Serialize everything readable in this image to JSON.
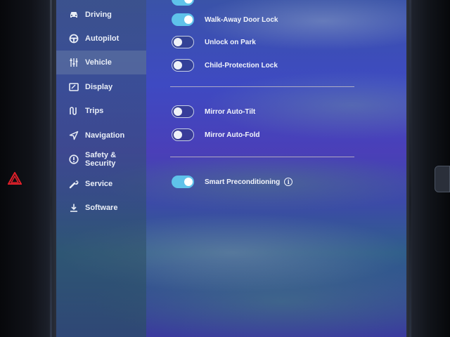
{
  "sidebar": {
    "items": [
      {
        "label": "Driving",
        "icon": "car-icon",
        "active": false
      },
      {
        "label": "Autopilot",
        "icon": "steering-wheel-icon",
        "active": false
      },
      {
        "label": "Vehicle",
        "icon": "sliders-icon",
        "active": true
      },
      {
        "label": "Display",
        "icon": "display-icon",
        "active": false
      },
      {
        "label": "Trips",
        "icon": "trips-icon",
        "active": false
      },
      {
        "label": "Navigation",
        "icon": "navigation-arrow-icon",
        "active": false
      },
      {
        "label_line1": "Safety &",
        "label_line2": "Security",
        "icon": "alert-circle-icon",
        "active": false
      },
      {
        "label": "Service",
        "icon": "wrench-icon",
        "active": false
      },
      {
        "label": "Software",
        "icon": "download-icon",
        "active": false
      }
    ]
  },
  "settings": {
    "walk_away_door_lock": {
      "label": "Walk-Away Door Lock",
      "enabled": true
    },
    "unlock_on_park": {
      "label": "Unlock on Park",
      "enabled": false
    },
    "child_protection_lock": {
      "label": "Child-Protection Lock",
      "enabled": false
    },
    "mirror_auto_tilt": {
      "label": "Mirror Auto-Tilt",
      "enabled": false
    },
    "mirror_auto_fold": {
      "label": "Mirror Auto-Fold",
      "enabled": false
    },
    "smart_preconditioning": {
      "label": "Smart Preconditioning",
      "enabled": true,
      "info_symbol": "i"
    }
  },
  "colors": {
    "toggle_on": "#5fc2ea",
    "hazard": "#e0202a",
    "sidebar_active": "#5a6ea0"
  }
}
